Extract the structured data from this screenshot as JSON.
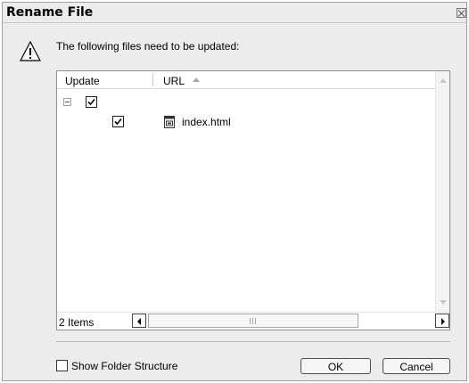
{
  "dialog": {
    "title": "Rename File",
    "message": "The following files need to be updated:"
  },
  "table": {
    "columns": [
      "Update",
      "URL"
    ],
    "rows": [
      {
        "checked": true,
        "expanded": true,
        "name": ""
      },
      {
        "checked": true,
        "icon": "html-file-icon",
        "name": "index.html"
      }
    ],
    "item_count": "2 Items"
  },
  "options": {
    "show_folder_structure": "Show Folder Structure",
    "show_folder_structure_checked": false
  },
  "buttons": {
    "ok": "OK",
    "cancel": "Cancel"
  }
}
